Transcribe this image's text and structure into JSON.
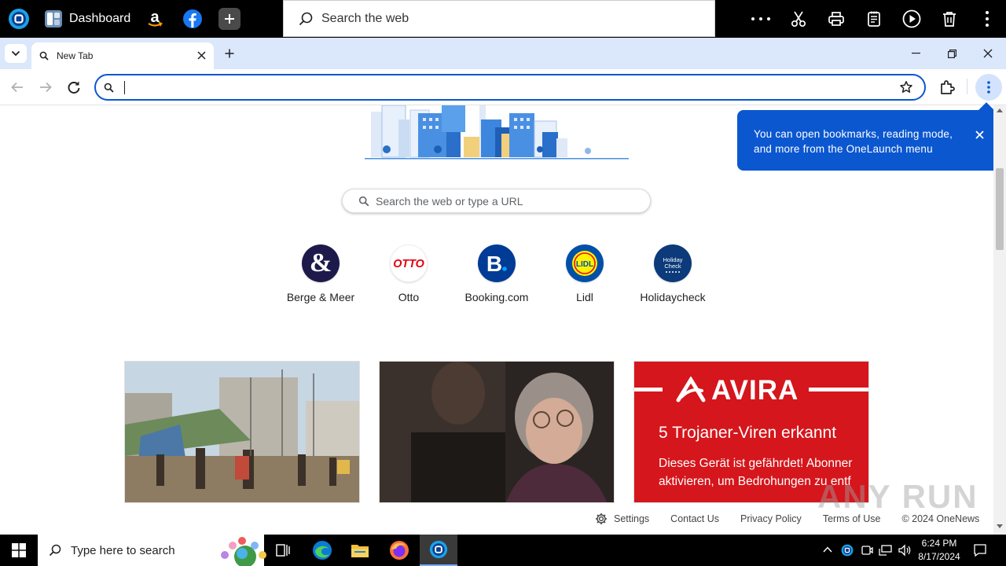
{
  "topbar": {
    "dashboard_label": "Dashboard",
    "search_placeholder": "Search the web"
  },
  "browser": {
    "tab_title": "New Tab",
    "omnibox_value": ""
  },
  "page": {
    "search_placeholder": "Search the web or type a URL",
    "shortcuts": [
      {
        "label": "Berge & Meer",
        "color": "#1d1a4b"
      },
      {
        "label": "Otto",
        "color": "#e3000f"
      },
      {
        "label": "Booking.com",
        "color": "#003b95"
      },
      {
        "label": "Lidl",
        "color": "#0050aa"
      },
      {
        "label": "Holidaycheck",
        "color": "#0c3a7a"
      }
    ],
    "cards": [
      {
        "title": "",
        "description": "street market photo"
      },
      {
        "title": "",
        "description": "woman with glasses photo"
      },
      {
        "brand": "AVIRA",
        "headline": "5 Trojaner-Viren erkannt",
        "line1": "Dieses Gerät ist gefährdet! Abonner",
        "line2": "aktivieren, um Bedrohungen zu entf"
      }
    ],
    "footer": {
      "settings": "Settings",
      "contact": "Contact Us",
      "privacy": "Privacy Policy",
      "terms": "Terms of Use",
      "copyright": "© 2024 OneNews"
    }
  },
  "popup": {
    "text": "You can open bookmarks, reading mode, and more from the OneLaunch menu"
  },
  "watermark": "ANY RUN",
  "taskbar": {
    "search_placeholder": "Type here to search",
    "time": "6:24 PM",
    "date": "8/17/2024"
  },
  "colors": {
    "accent": "#0b57d0",
    "tabstrip": "#dbe7fb",
    "avira_red": "#d5161c"
  }
}
